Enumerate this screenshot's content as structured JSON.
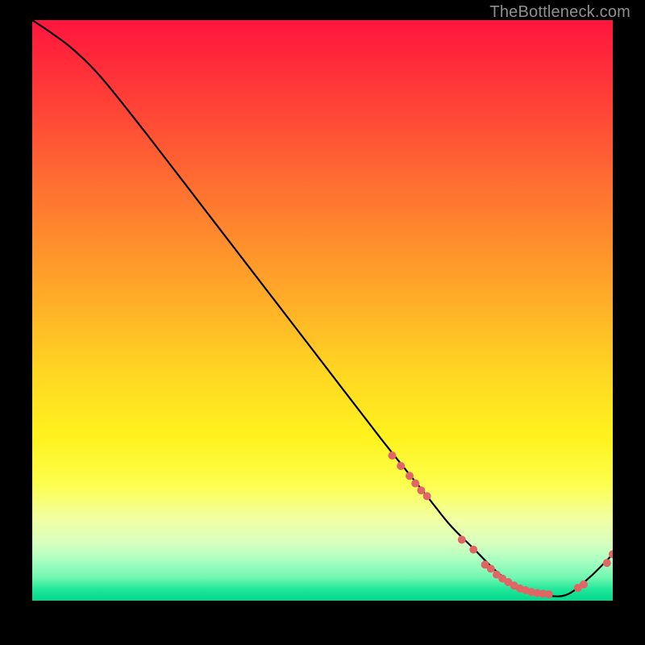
{
  "attribution": "TheBottleneck.com",
  "chart_data": {
    "type": "line",
    "title": "",
    "xlabel": "",
    "ylabel": "",
    "xlim": [
      0,
      100
    ],
    "ylim": [
      0,
      100
    ],
    "grid": false,
    "series": [
      {
        "name": "curve",
        "color": "#000000",
        "x": [
          0,
          3,
          7,
          12,
          20,
          30,
          40,
          50,
          60,
          68,
          72,
          76,
          80,
          84,
          88,
          92,
          96,
          100
        ],
        "y": [
          100,
          98,
          95,
          90,
          80,
          67,
          54,
          41,
          28,
          18,
          13,
          9,
          5,
          2,
          1,
          1,
          4,
          8
        ]
      },
      {
        "name": "markers",
        "color": "#e06666",
        "type": "scatter",
        "x": [
          62,
          63.5,
          65,
          66,
          67,
          68,
          74,
          76,
          78,
          79,
          80,
          81,
          82,
          83,
          84,
          85,
          86,
          87,
          88,
          89,
          94,
          95,
          99,
          100
        ],
        "y": [
          25,
          23.2,
          21.5,
          20.2,
          19,
          18,
          10.5,
          8.8,
          6.2,
          5.5,
          4.5,
          3.8,
          3.2,
          2.6,
          2.1,
          1.8,
          1.5,
          1.3,
          1.2,
          1.1,
          2.2,
          2.8,
          6.5,
          8
        ]
      }
    ]
  }
}
